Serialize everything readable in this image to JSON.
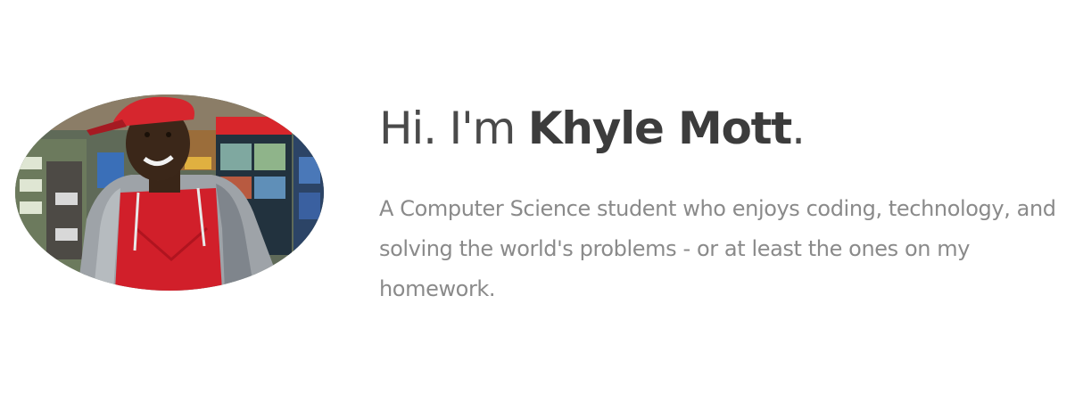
{
  "profile": {
    "photo_alt": "Profile photo",
    "greeting": "Hi. I'm ",
    "name": "Khyle Mott",
    "punctuation": ".",
    "tagline_lines": [
      "A Computer Science student who enjoys coding, technology, and",
      "solving the world's problems - or at least the ones on my",
      "homework."
    ]
  },
  "colors": {
    "background": "#ffffff",
    "headline": "#444444",
    "tagline": "#8a8a8a"
  }
}
